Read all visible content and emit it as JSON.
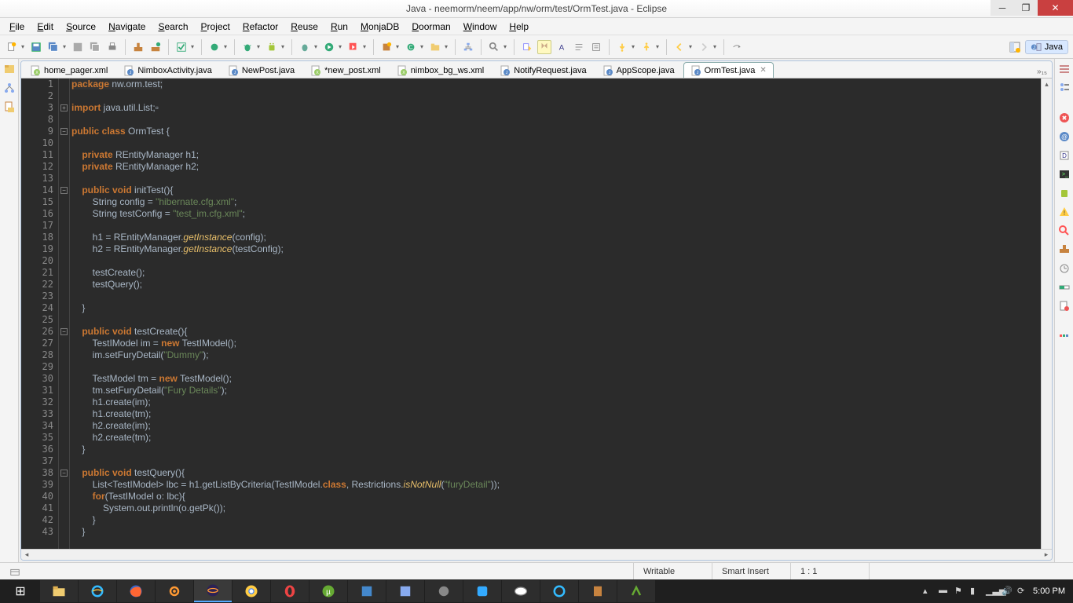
{
  "window": {
    "title": "Java - neemorm/neem/app/nw/orm/test/OrmTest.java - Eclipse"
  },
  "menus": [
    "File",
    "Edit",
    "Source",
    "Navigate",
    "Search",
    "Project",
    "Refactor",
    "Reuse",
    "Run",
    "MonjaDB",
    "Doorman",
    "Window",
    "Help"
  ],
  "perspective": {
    "label": "Java"
  },
  "tabs": [
    {
      "label": "home_pager.xml",
      "icon": "xml"
    },
    {
      "label": "NimboxActivity.java",
      "icon": "java"
    },
    {
      "label": "NewPost.java",
      "icon": "java"
    },
    {
      "label": "*new_post.xml",
      "icon": "xml"
    },
    {
      "label": "nimbox_bg_ws.xml",
      "icon": "xml"
    },
    {
      "label": "NotifyRequest.java",
      "icon": "java"
    },
    {
      "label": "AppScope.java",
      "icon": "java"
    },
    {
      "label": "OrmTest.java",
      "icon": "java",
      "active": true
    }
  ],
  "tab_overflow": "»₁₅",
  "code_lines": [
    {
      "n": 1,
      "html": "<span class='kw'>package</span> nw.orm.test;"
    },
    {
      "n": 2,
      "html": ""
    },
    {
      "n": 3,
      "html": "<span class='kw'>import</span> java.util.List;▫"
    },
    {
      "n": 8,
      "html": ""
    },
    {
      "n": 9,
      "html": "<span class='kw'>public class</span> OrmTest {"
    },
    {
      "n": 10,
      "html": ""
    },
    {
      "n": 11,
      "html": "    <span class='kw'>private</span> REntityManager h1;"
    },
    {
      "n": 12,
      "html": "    <span class='kw'>private</span> REntityManager h2;"
    },
    {
      "n": 13,
      "html": ""
    },
    {
      "n": 14,
      "html": "    <span class='kw'>public void</span> initTest(){"
    },
    {
      "n": 15,
      "html": "        String config = <span class='str'>\"hibernate.cfg.xml\"</span>;"
    },
    {
      "n": 16,
      "html": "        String testConfig = <span class='str'>\"test_im.cfg.xml\"</span>;"
    },
    {
      "n": 17,
      "html": ""
    },
    {
      "n": 18,
      "html": "        h1 = REntityManager.<span class='mtd'>getInstance</span>(config);"
    },
    {
      "n": 19,
      "html": "        h2 = REntityManager.<span class='mtd'>getInstance</span>(testConfig);"
    },
    {
      "n": 20,
      "html": ""
    },
    {
      "n": 21,
      "html": "        testCreate();"
    },
    {
      "n": 22,
      "html": "        testQuery();"
    },
    {
      "n": 23,
      "html": ""
    },
    {
      "n": 24,
      "html": "    }"
    },
    {
      "n": 25,
      "html": ""
    },
    {
      "n": 26,
      "html": "    <span class='kw'>public void</span> testCreate(){"
    },
    {
      "n": 27,
      "html": "        TestIModel im = <span class='kw'>new</span> TestIModel();"
    },
    {
      "n": 28,
      "html": "        im.setFuryDetail(<span class='str'>\"Dummy\"</span>);"
    },
    {
      "n": 29,
      "html": ""
    },
    {
      "n": 30,
      "html": "        TestModel tm = <span class='kw'>new</span> TestModel();"
    },
    {
      "n": 31,
      "html": "        tm.setFuryDetail(<span class='str'>\"Fury Details\"</span>);"
    },
    {
      "n": 32,
      "html": "        h1.create(im);"
    },
    {
      "n": 33,
      "html": "        h1.create(tm);"
    },
    {
      "n": 34,
      "html": "        h2.create(im);"
    },
    {
      "n": 35,
      "html": "        h2.create(tm);"
    },
    {
      "n": 36,
      "html": "    }"
    },
    {
      "n": 37,
      "html": ""
    },
    {
      "n": 38,
      "html": "    <span class='kw'>public void</span> testQuery(){"
    },
    {
      "n": 39,
      "html": "        List&lt;TestIModel&gt; lbc = h1.getListByCriteria(TestIModel.<span class='kw'>class</span>, Restrictions.<span class='mtd'>isNotNull</span>(<span class='str'>\"furyDetail\"</span>));"
    },
    {
      "n": 40,
      "html": "        <span class='kw'>for</span>(TestIModel o: lbc){"
    },
    {
      "n": 41,
      "html": "            System.out.println(o.getPk());"
    },
    {
      "n": 42,
      "html": "        }"
    },
    {
      "n": 43,
      "html": "    }"
    }
  ],
  "status": {
    "writable": "Writable",
    "insert": "Smart Insert",
    "pos": "1 : 1"
  },
  "clock": "5:00 PM"
}
